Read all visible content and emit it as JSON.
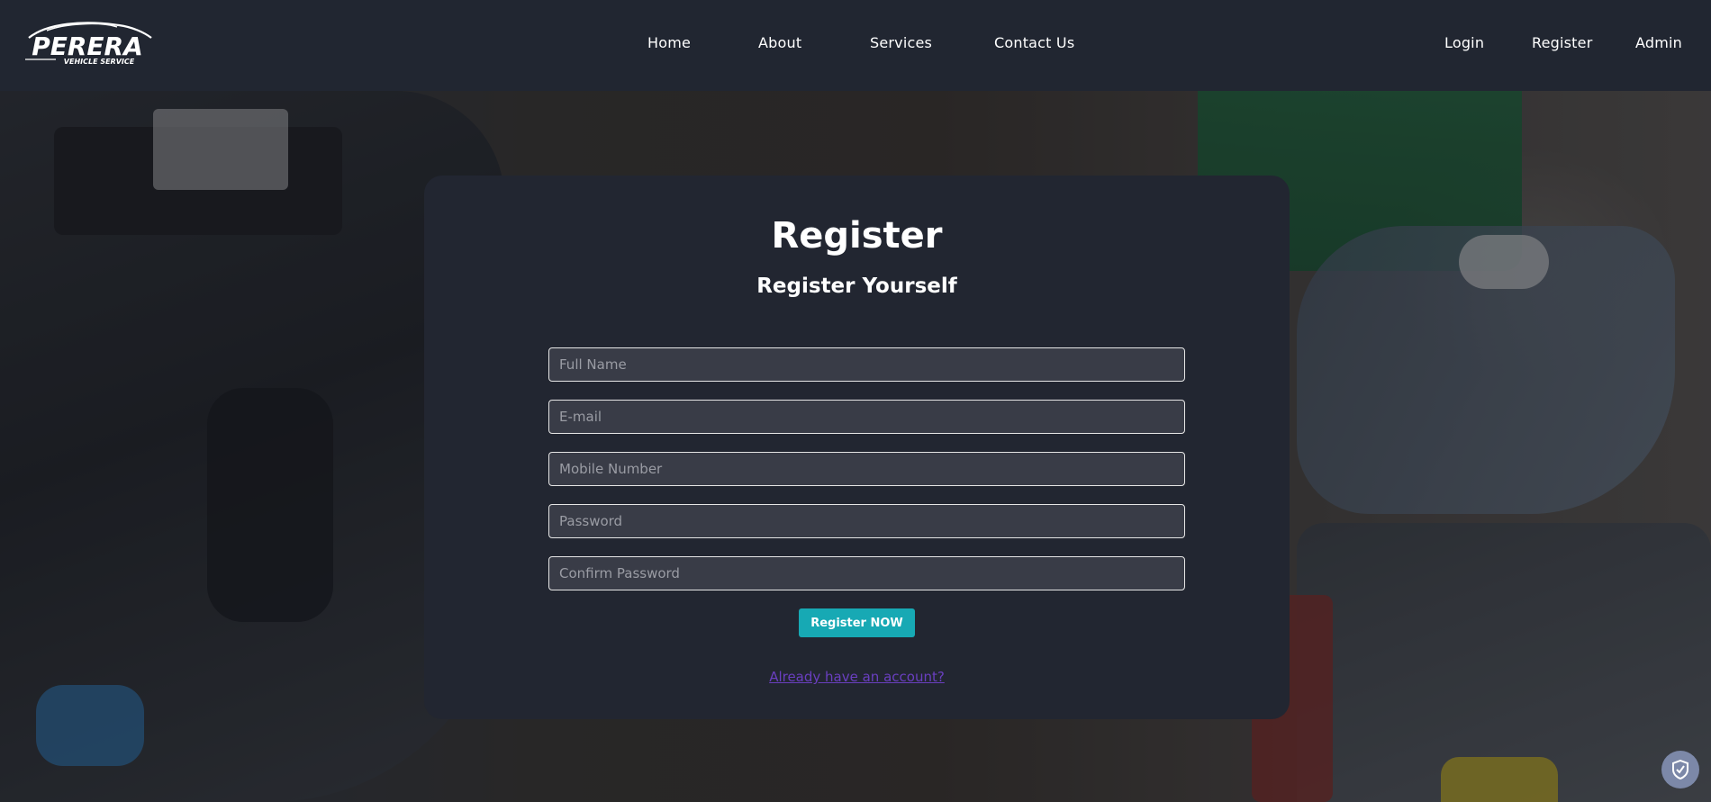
{
  "brand": {
    "name": "PERERA",
    "tagline": "VEHICLE SERVICE"
  },
  "nav": {
    "center": [
      "Home",
      "About",
      "Services",
      "Contact Us"
    ],
    "right": [
      "Login",
      "Register",
      "Admin"
    ]
  },
  "form": {
    "title": "Register",
    "subtitle": "Register Yourself",
    "fields": [
      {
        "placeholder": "Full Name",
        "value": ""
      },
      {
        "placeholder": "E-mail",
        "value": ""
      },
      {
        "placeholder": "Mobile Number",
        "value": ""
      },
      {
        "placeholder": "Password",
        "value": ""
      },
      {
        "placeholder": "Confirm Password",
        "value": ""
      }
    ],
    "submit_label": "Register NOW",
    "login_link": "Already have an account?"
  },
  "colors": {
    "navbar": "#212631",
    "card": "#222631",
    "field_bg": "#393c47",
    "button": "#17a9b4",
    "link": "#6a3fc0"
  },
  "icons": {
    "logo": "car-silhouette-logo",
    "badge": "shield-check-icon"
  }
}
